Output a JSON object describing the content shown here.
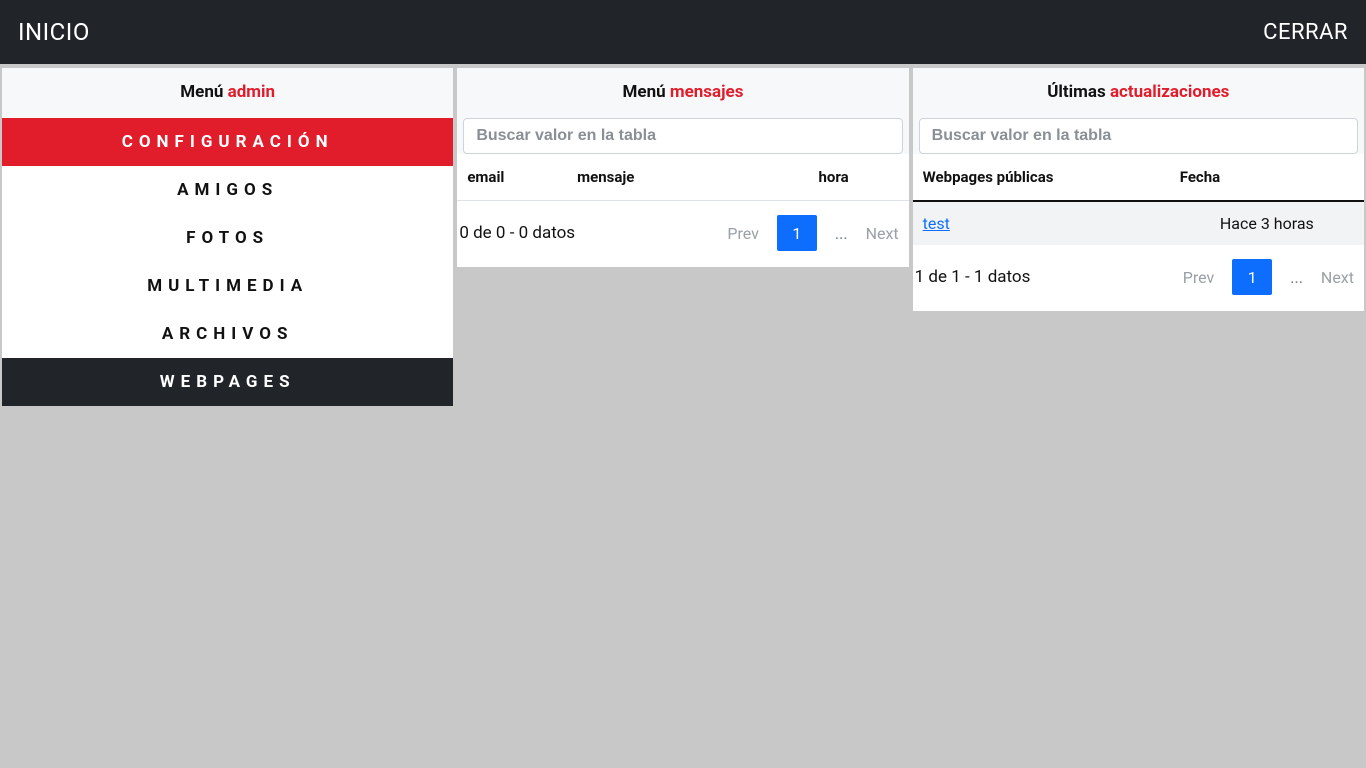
{
  "topbar": {
    "home": "INICIO",
    "close": "CERRAR"
  },
  "sidebar": {
    "title_prefix": "Menú ",
    "title_accent": "admin",
    "items": [
      {
        "label": "CONFIGURACIÓN",
        "state": "active"
      },
      {
        "label": "AMIGOS",
        "state": ""
      },
      {
        "label": "FOTOS",
        "state": ""
      },
      {
        "label": "MULTIMEDIA",
        "state": ""
      },
      {
        "label": "ARCHIVOS",
        "state": ""
      },
      {
        "label": "WEBPAGES",
        "state": "dark"
      }
    ]
  },
  "messages": {
    "title_prefix": "Menú ",
    "title_accent": "mensajes",
    "search_placeholder": "Buscar valor en la tabla",
    "columns": {
      "c0": "email",
      "c1": "mensaje",
      "c2": "hora"
    },
    "summary": "0 de 0 - 0 datos",
    "pager": {
      "prev": "Prev",
      "page": "1",
      "dots": "...",
      "next": "Next"
    }
  },
  "updates": {
    "title_prefix": "Últimas ",
    "title_accent": "actualizaciones",
    "search_placeholder": "Buscar valor en la tabla",
    "columns": {
      "c0": "Webpages públicas",
      "c1": "Fecha"
    },
    "rows": [
      {
        "name": "test",
        "date": "Hace 3 horas"
      }
    ],
    "summary": "1 de 1 - 1 datos",
    "pager": {
      "prev": "Prev",
      "page": "1",
      "dots": "...",
      "next": "Next"
    }
  }
}
